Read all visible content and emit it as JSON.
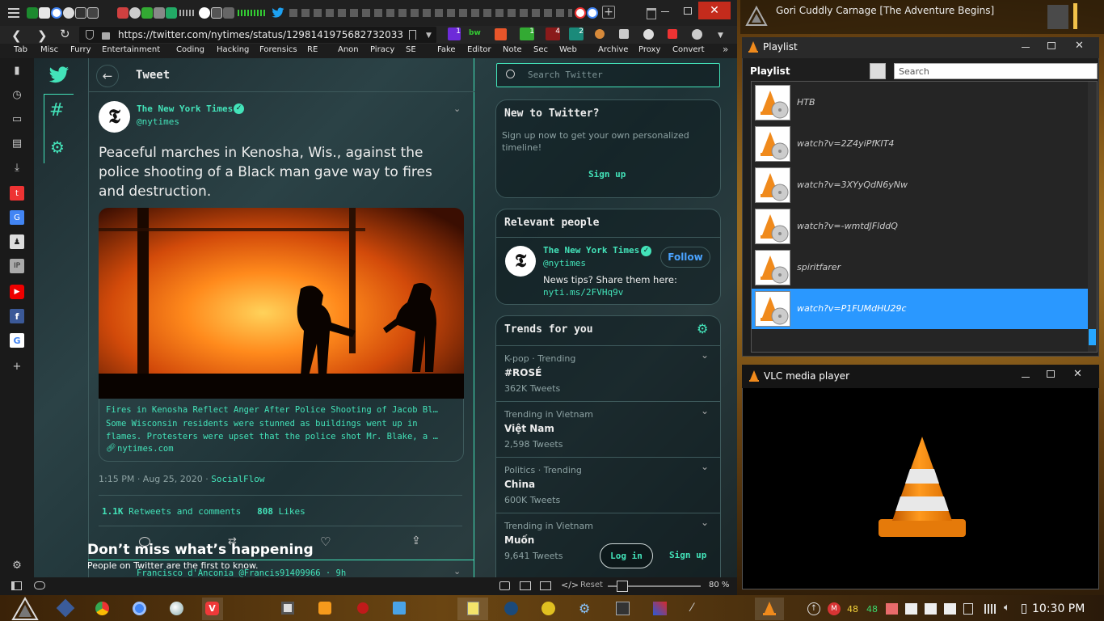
{
  "browser": {
    "url": "https://twitter.com/nytimes/status/1298141975682732033",
    "ext_badges": [
      "1",
      "bw",
      "1",
      "4",
      "2"
    ],
    "bookmarks": [
      "Tab",
      "Misc",
      "Furry",
      "Entertainment",
      "Coding",
      "Hacking",
      "Forensics",
      "RE",
      "Anon",
      "Piracy",
      "SE",
      "Fake",
      "Editor",
      "Note",
      "Sec",
      "Web",
      "Archive",
      "Proxy",
      "Convert"
    ],
    "status": {
      "reset_label": "Reset",
      "zoom": "80 %"
    }
  },
  "twitter": {
    "header_title": "Tweet",
    "author_name": "The New York Times",
    "author_handle": "@nytimes",
    "tweet_text": "Peaceful marches in Kenosha, Wis., against the police shooting of a Black man gave way to fires and destruction.",
    "link_title": "Fires in Kenosha Reflect Anger After Police Shooting of Jacob Bl…",
    "link_desc": "Some Wisconsin residents were stunned as buildings went up in flames. Protesters were upset that the police shot Mr. Blake, a …",
    "link_domain": "nytimes.com",
    "timestamp": "1:15 PM · Aug 25, 2020 · ",
    "source": "SocialFlow",
    "retweets_count": "1.1K",
    "retweets_label": "Retweets and comments",
    "likes_count": "808",
    "likes_label": "Likes",
    "reply_name": "Francisco d'Anconia",
    "reply_handle": "@Francis91409966 · 9h",
    "banner_title": "Don’t miss what’s happening",
    "banner_sub": "People on Twitter are the first to know.",
    "login_label": "Log in",
    "signup_label": "Sign up",
    "search_placeholder": "Search Twitter",
    "new_title": "New to Twitter?",
    "new_desc": "Sign up now to get your own personalized timeline!",
    "new_signup": "Sign up",
    "relevant_title": "Relevant people",
    "rel_name": "The New York Times",
    "rel_handle": "@nytimes",
    "follow_label": "Follow",
    "rel_bio": "News tips? Share them here:",
    "rel_link": "nyti.ms/2FVHq9v",
    "trends_title": "Trends for you",
    "trends": [
      {
        "context": "K-pop · Trending",
        "name": "#ROSÉ",
        "count": "362K Tweets"
      },
      {
        "context": "Trending in Vietnam",
        "name": "Việt Nam",
        "count": "2,598 Tweets"
      },
      {
        "context": "Politics · Trending",
        "name": "China",
        "count": "600K Tweets"
      },
      {
        "context": "Trending in Vietnam",
        "name": "Muốn",
        "count": "9,641 Tweets"
      }
    ]
  },
  "desktop": {
    "media_title": "Gori Cuddly Carnage [The Adventure Begins]"
  },
  "playlist": {
    "window_title": "Playlist",
    "panel_label": "Playlist",
    "search_placeholder": "Search",
    "items": [
      "HTB",
      "watch?v=2Z4yiPfKIT4",
      "watch?v=3XYyQdN6yNw",
      "watch?v=-wmtdJFlddQ",
      "spiritfarer",
      "watch?v=P1FUMdHU29c"
    ],
    "selected_index": 5
  },
  "vlc": {
    "window_title": "VLC media player"
  },
  "taskbar": {
    "badge_a": "48",
    "badge_b": "48",
    "clock": "10:30 PM"
  }
}
